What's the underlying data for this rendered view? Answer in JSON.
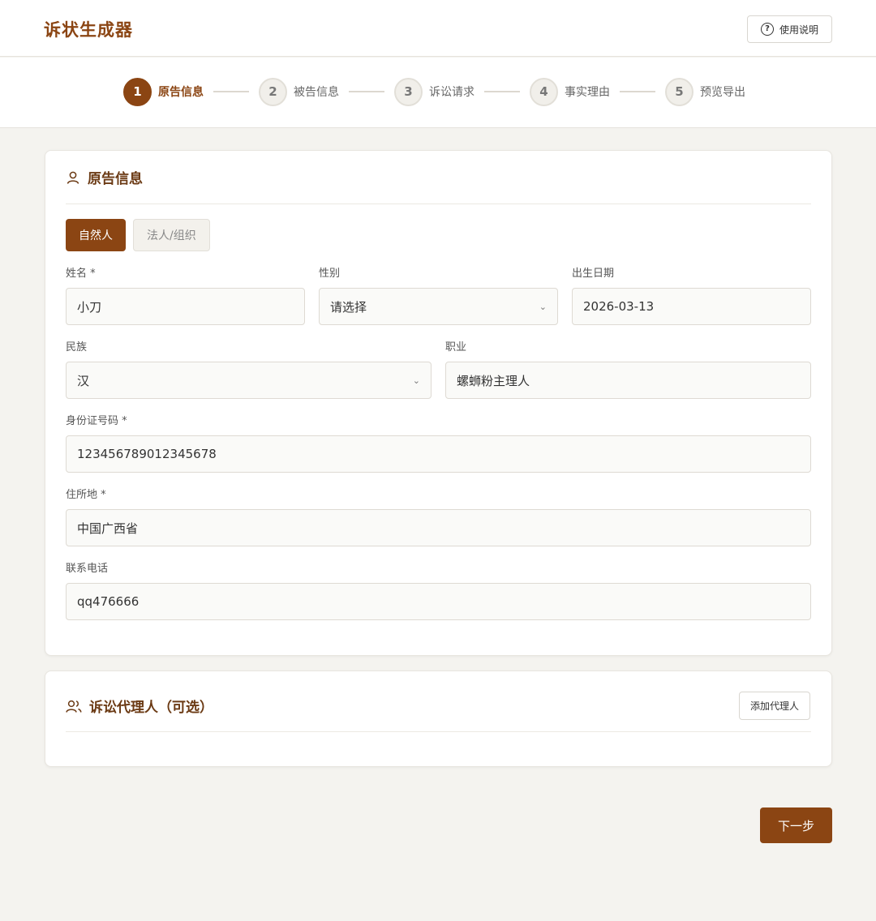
{
  "app": {
    "title": "诉状生成器",
    "help_label": "使用说明"
  },
  "steps": [
    {
      "num": "1",
      "label": "原告信息",
      "active": true
    },
    {
      "num": "2",
      "label": "被告信息",
      "active": false
    },
    {
      "num": "3",
      "label": "诉讼请求",
      "active": false
    },
    {
      "num": "4",
      "label": "事实理由",
      "active": false
    },
    {
      "num": "5",
      "label": "预览导出",
      "active": false
    }
  ],
  "plaintiff": {
    "title": "原告信息",
    "types": [
      "自然人",
      "法人/组织"
    ],
    "selected_type": "自然人",
    "fields": {
      "name": {
        "label": "姓名 *",
        "value": "小刀"
      },
      "gender": {
        "label": "性别",
        "value": "请选择"
      },
      "birth": {
        "label": "出生日期",
        "value": "2026-03-13"
      },
      "ethnicity": {
        "label": "民族",
        "value": "汉"
      },
      "occupation": {
        "label": "职业",
        "value": "螺蛳粉主理人"
      },
      "id_number": {
        "label": "身份证号码 *",
        "value": "123456789012345678"
      },
      "address": {
        "label": "住所地 *",
        "value": "中国广西省"
      },
      "phone": {
        "label": "联系电话",
        "value": "qq476666"
      }
    }
  },
  "agent": {
    "title": "诉讼代理人（可选）",
    "add_label": "添加代理人"
  },
  "footer": {
    "next_label": "下一步"
  },
  "colors": {
    "accent": "#8b4513",
    "background": "#f4f3ef"
  }
}
